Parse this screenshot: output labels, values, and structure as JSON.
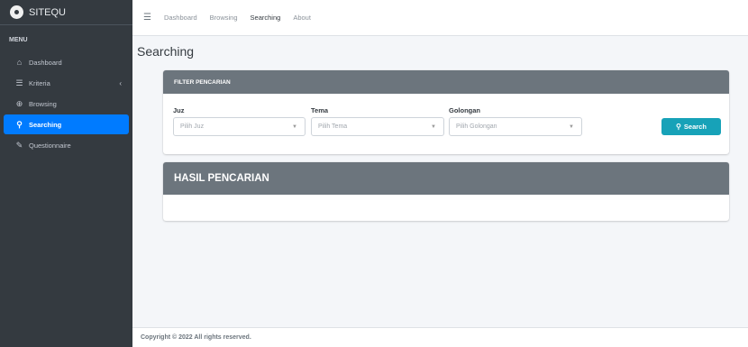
{
  "brand": {
    "name": "SITEQU"
  },
  "sidebar": {
    "header": "MENU",
    "items": [
      {
        "label": "Dashboard",
        "icon": "home-icon"
      },
      {
        "label": "Kriteria",
        "icon": "list-icon",
        "arrow": "‹"
      },
      {
        "label": "Browsing",
        "icon": "globe-icon"
      },
      {
        "label": "Searching",
        "icon": "search-icon",
        "active": true
      },
      {
        "label": "Questionnaire",
        "icon": "pencil-icon"
      }
    ]
  },
  "topnav": {
    "links": [
      "Dashboard",
      "Browsing",
      "Searching",
      "About"
    ],
    "active": "Searching"
  },
  "page": {
    "title": "Searching"
  },
  "filter": {
    "header": "FILTER PENCARIAN",
    "juz": {
      "label": "Juz",
      "placeholder": "Pilih Juz"
    },
    "tema": {
      "label": "Tema",
      "placeholder": "Pilih Tema"
    },
    "golongan": {
      "label": "Golongan",
      "placeholder": "Pilih Golongan"
    },
    "search_label": "Search"
  },
  "result": {
    "header": "HASIL PENCARIAN"
  },
  "footer": {
    "text": "Copyright © 2022 All rights reserved."
  },
  "colors": {
    "sidebar_bg": "#343a40",
    "active": "#007bff",
    "card_header": "#6c757d",
    "search_btn": "#17a2b8"
  }
}
